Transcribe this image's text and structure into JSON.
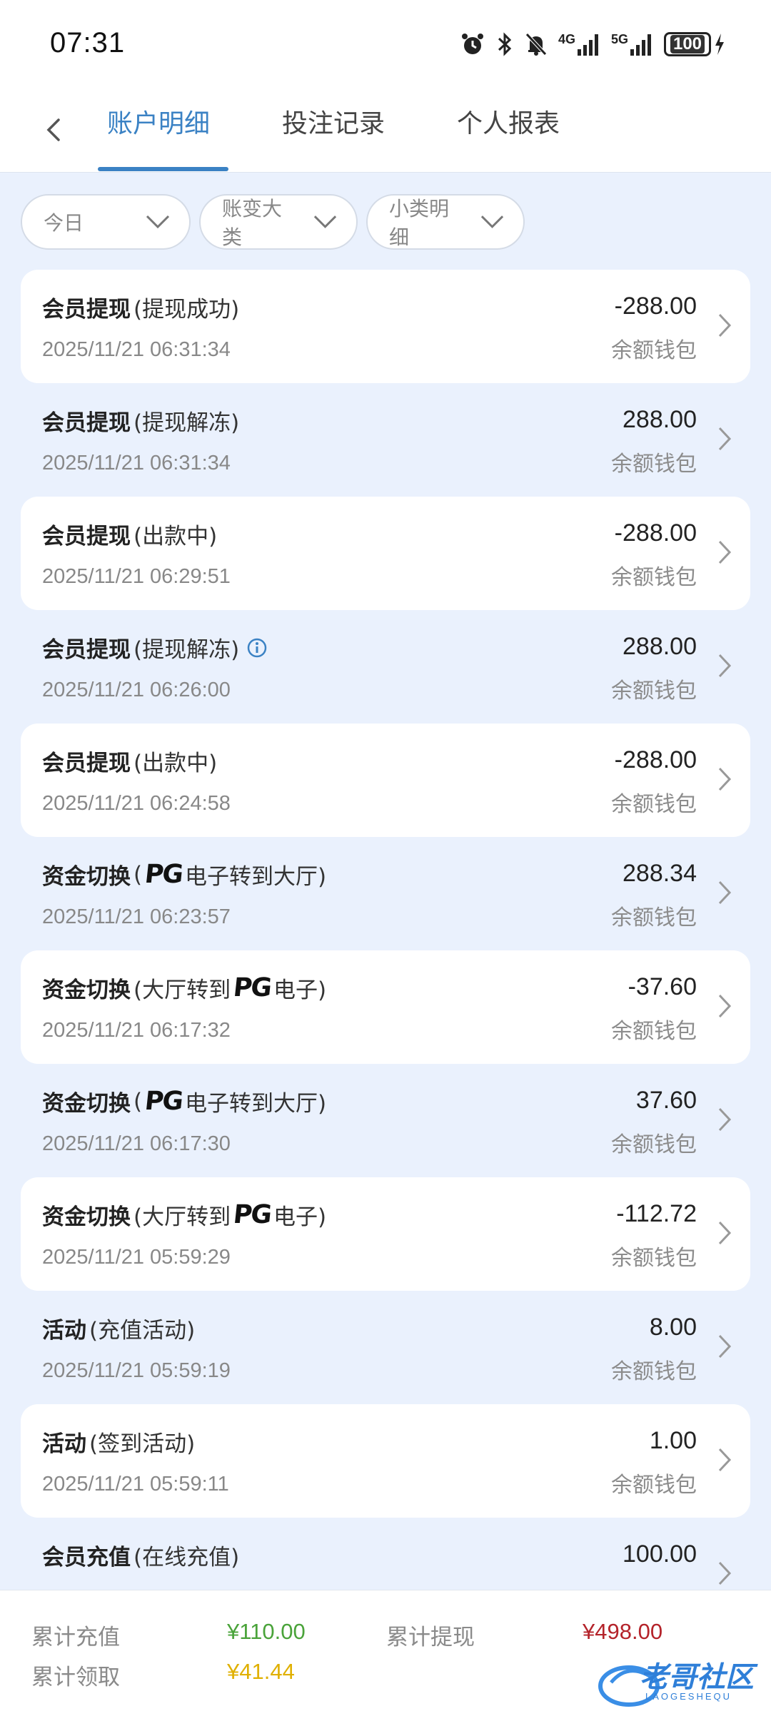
{
  "status": {
    "time": "07:31",
    "battery": "100",
    "net1": "4G",
    "net2": "5G"
  },
  "tabs": [
    {
      "label": "账户明细",
      "active": true
    },
    {
      "label": "投注记录",
      "active": false
    },
    {
      "label": "个人报表",
      "active": false
    }
  ],
  "filters": [
    {
      "label": "今日"
    },
    {
      "label": "账变大类"
    },
    {
      "label": "小类明细"
    }
  ],
  "records": [
    {
      "main": "会员提现",
      "sub": "(提现成功)",
      "time": "2025/11/21 06:31:34",
      "amount": "-288.00",
      "wallet": "余额钱包"
    },
    {
      "main": "会员提现",
      "sub": "(提现解冻)",
      "time": "2025/11/21 06:31:34",
      "amount": "288.00",
      "wallet": "余额钱包"
    },
    {
      "main": "会员提现",
      "sub": "(出款中)",
      "time": "2025/11/21 06:29:51",
      "amount": "-288.00",
      "wallet": "余额钱包"
    },
    {
      "main": "会员提现",
      "sub": "(提现解冻)",
      "time": "2025/11/21 06:26:00",
      "amount": "288.00",
      "wallet": "余额钱包",
      "info": true
    },
    {
      "main": "会员提现",
      "sub": "(出款中)",
      "time": "2025/11/21 06:24:58",
      "amount": "-288.00",
      "wallet": "余额钱包"
    },
    {
      "main": "资金切换",
      "sub_pre": "(",
      "pg": "PG",
      "sub_post": "电子转到大厅)",
      "time": "2025/11/21 06:23:57",
      "amount": "288.34",
      "wallet": "余额钱包"
    },
    {
      "main": "资金切换",
      "sub_pre": "(大厅转到",
      "pg": "PG",
      "sub_post": "电子)",
      "time": "2025/11/21 06:17:32",
      "amount": "-37.60",
      "wallet": "余额钱包"
    },
    {
      "main": "资金切换",
      "sub_pre": "(",
      "pg": "PG",
      "sub_post": "电子转到大厅)",
      "time": "2025/11/21 06:17:30",
      "amount": "37.60",
      "wallet": "余额钱包"
    },
    {
      "main": "资金切换",
      "sub_pre": "(大厅转到",
      "pg": "PG",
      "sub_post": "电子)",
      "time": "2025/11/21 05:59:29",
      "amount": "-112.72",
      "wallet": "余额钱包"
    },
    {
      "main": "活动",
      "sub": "(充值活动)",
      "time": "2025/11/21 05:59:19",
      "amount": "8.00",
      "wallet": "余额钱包"
    },
    {
      "main": "活动",
      "sub": "(签到活动)",
      "time": "2025/11/21 05:59:11",
      "amount": "1.00",
      "wallet": "余额钱包"
    },
    {
      "main": "会员充值",
      "sub": "(在线充值)",
      "time": "",
      "amount": "100.00",
      "wallet": ""
    }
  ],
  "summary": {
    "total_deposit_label": "累计充值",
    "total_deposit_value": "¥110.00",
    "total_withdraw_label": "累计提现",
    "total_withdraw_value": "¥498.00",
    "total_claim_label": "累计领取",
    "total_claim_value": "¥41.44"
  },
  "watermark": {
    "title": "老哥社区",
    "sub": "LAOGESHEQU"
  },
  "colors": {
    "accent": "#3b82c4",
    "deposit": "#4aa33a",
    "withdraw": "#b4232a",
    "claim": "#e0b000"
  }
}
